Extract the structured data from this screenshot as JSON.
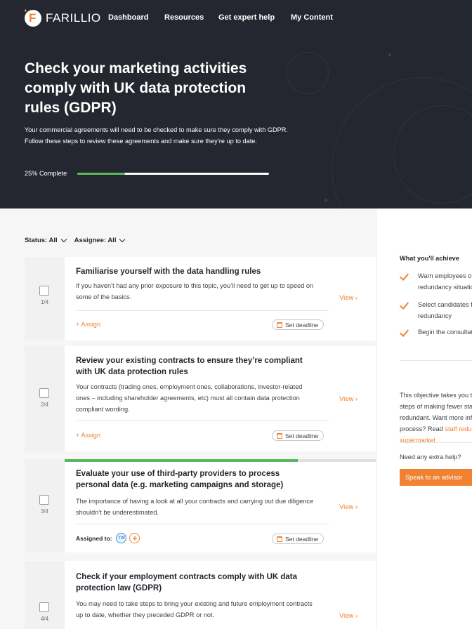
{
  "brand": {
    "name": "FARILLIO",
    "accent": "#f08232"
  },
  "nav": [
    "Dashboard",
    "Resources",
    "Get expert help",
    "My Content"
  ],
  "hero": {
    "title": "Check your marketing activities comply with UK data protection rules (GDPR)",
    "description": "Your commercial agreements will need to be checked to make sure they comply with GDPR. Follow these steps to review these agreements and make sure they’re up to date.",
    "progress_label": "25% Complete",
    "progress_fraction": 0.25
  },
  "filters": {
    "status": "Status: All",
    "assignee": "Assignee: All"
  },
  "steps": [
    {
      "number": "1/4",
      "title": "Familiarise yourself with the data handling rules",
      "description": "If you haven’t had any prior exposure to this topic, you’ll need to get up to speed on some of the basics.",
      "view": "View",
      "assign": "Assign",
      "deadline": "Set deadline"
    },
    {
      "number": "2/4",
      "title": "Review your existing contracts to ensure they’re compliant with UK data protection rules",
      "description": "Your contracts (trading ones, employment ones, collaborations, investor-related ones – including shareholder agreements, etc) must all contain data protection compliant wording.",
      "view": "View",
      "assign": "Assign",
      "deadline": "Set deadline"
    },
    {
      "number": "3/4",
      "title": "Evaluate your use of third-party providers to process personal data (e.g. marketing campaigns and storage)",
      "description": "The importance of having a look at all your contracts and carrying out due diligence shouldn’t be underestimated.",
      "view": "View",
      "assigned_label": "Assigned to:",
      "assignee_initials": "TW",
      "deadline": "Set deadline",
      "progress_fraction": 0.75
    },
    {
      "number": "4/4",
      "title": "Check if your employment contracts comply with UK data protection law (GDPR)",
      "description": "You may need to take steps to bring your existing and future employment contracts up to date, whether they preceded GDPR or not.",
      "view": "View"
    }
  ],
  "sidebar": {
    "achieve_title": "What you'll achieve",
    "achieve_items": [
      "Warn employees of the redundancy situation",
      "Select candidates for redundancy",
      "Begin the consultation with them"
    ],
    "objective_text": "This objective takes you through the steps of making fewer staff or people redundant. Want more info on the process? Read",
    "objective_link": "staff redundant supermarket",
    "help_text": "Need any extra help?",
    "advisor_button": "Speak to an advisor"
  }
}
